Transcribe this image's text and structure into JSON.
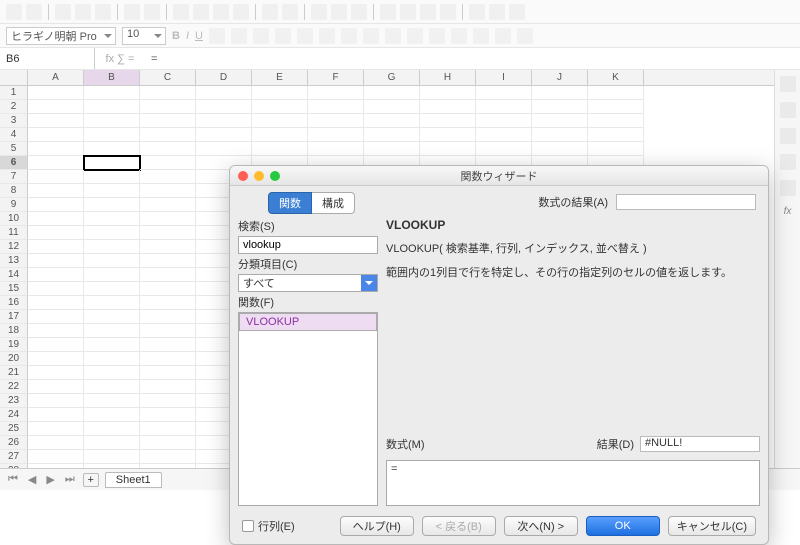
{
  "format": {
    "font_name": "ヒラギノ明朝 Pro",
    "font_size": "10"
  },
  "cellref": {
    "name": "B6",
    "formula": "="
  },
  "columns": [
    "A",
    "B",
    "C",
    "D",
    "E",
    "F",
    "G",
    "H",
    "I",
    "J",
    "K"
  ],
  "rowcount": 28,
  "selected_col": "B",
  "selected_row": 6,
  "sheet_tab": "Sheet1",
  "sidepanel_last": "fx",
  "dialog": {
    "title": "関数ウィザード",
    "tab_fn": "関数",
    "tab_st": "構成",
    "result_label": "数式の結果(A)",
    "search_label": "検索(S)",
    "search_value": "vlookup",
    "category_label": "分類項目(C)",
    "category_value": "すべて",
    "functions_label": "関数(F)",
    "list_item": "VLOOKUP",
    "fn_name": "VLOOKUP",
    "fn_sig": "VLOOKUP( 検索基準, 行列, インデックス, 並べ替え )",
    "fn_desc": "範囲内の1列目で行を特定し、その行の指定列のセルの値を返します。",
    "formula_label": "数式(M)",
    "formula_value": "=",
    "resultD_label": "結果(D)",
    "resultD_value": "#NULL!",
    "array_label": "行列(E)",
    "help": "ヘルプ(H)",
    "back": "< 戻る(B)",
    "next": "次へ(N) >",
    "ok": "OK",
    "cancel": "キャンセル(C)"
  }
}
